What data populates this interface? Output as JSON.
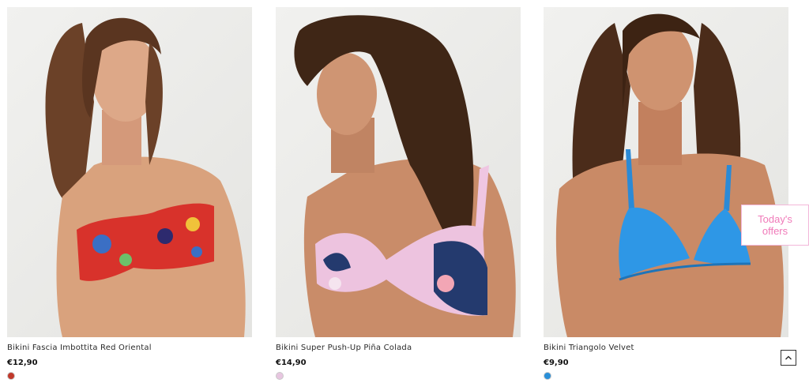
{
  "products": [
    {
      "name": "Bikini Fascia Imbottita Red Oriental",
      "price": "€12,90",
      "swatch_color": "#c0392b"
    },
    {
      "name": "Bikini Super Push-Up Piña Colada",
      "price": "€14,90",
      "swatch_color": "#e7c6e0"
    },
    {
      "name": "Bikini Triangolo Velvet",
      "price": "€9,90",
      "swatch_color": "#2a8fd8"
    }
  ],
  "offers_tab": {
    "line1": "Today's",
    "line2": "offers"
  },
  "icons": {
    "scroll_top": "chevron-up-icon"
  },
  "colors": {
    "offers_accent": "#f07ab9",
    "offers_border": "#f3b7d9"
  }
}
